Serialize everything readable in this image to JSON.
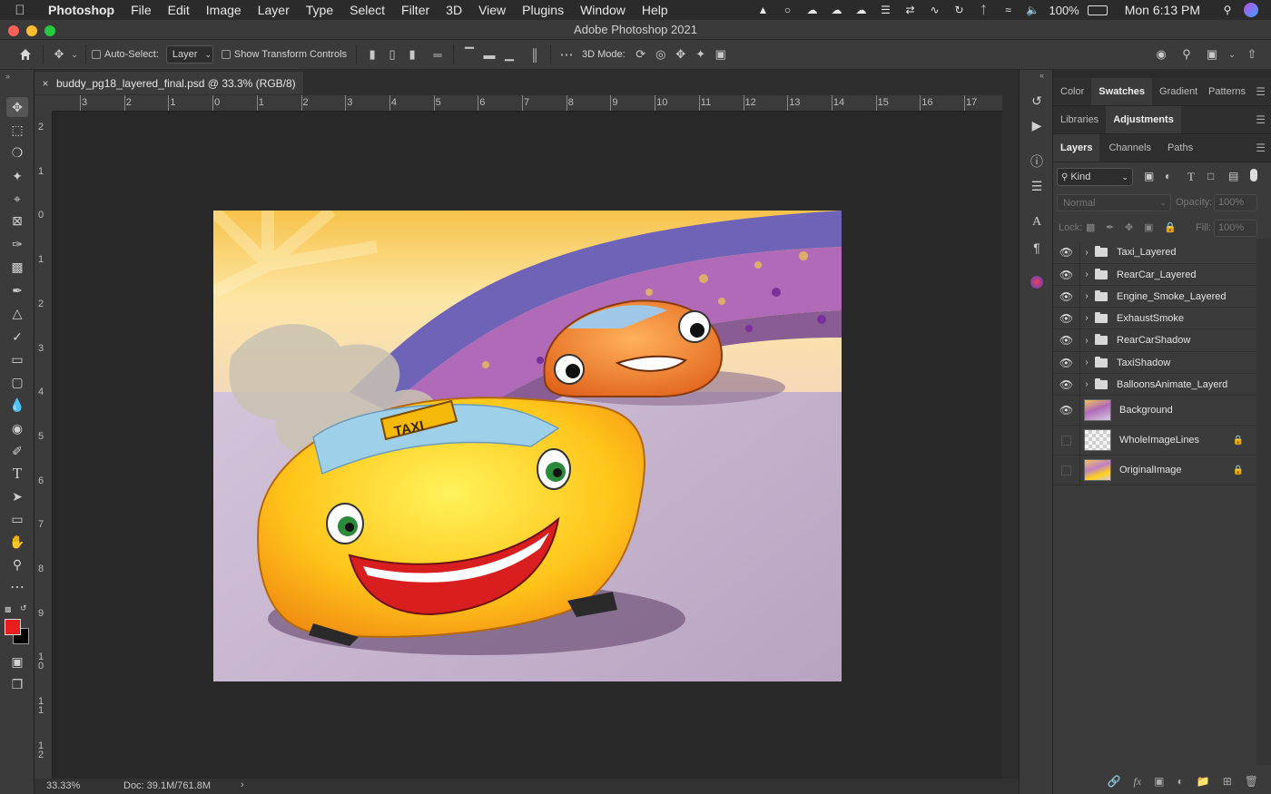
{
  "menubar": {
    "app_name": "Photoshop",
    "items": [
      "File",
      "Edit",
      "Image",
      "Layer",
      "Type",
      "Select",
      "Filter",
      "3D",
      "View",
      "Plugins",
      "Window",
      "Help"
    ],
    "battery": "100%",
    "clock": "Mon 6:13 PM"
  },
  "window": {
    "title": "Adobe Photoshop 2021"
  },
  "options": {
    "auto_select_label": "Auto-Select:",
    "auto_select_value": "Layer",
    "show_transform_label": "Show Transform Controls",
    "mode_label": "3D Mode:"
  },
  "document": {
    "tab_title": "buddy_pg18_layered_final.psd @ 33.3% (RGB/8)",
    "zoom": "33.33%",
    "doc_size": "Doc: 39.1M/761.8M"
  },
  "rulers": {
    "h": [
      "3",
      "2",
      "1",
      "0",
      "1",
      "2",
      "3",
      "4",
      "5",
      "6",
      "7",
      "8",
      "9",
      "10",
      "11",
      "12",
      "13",
      "14",
      "15",
      "16",
      "17"
    ],
    "v": [
      "2",
      "1",
      "0",
      "1",
      "2",
      "3",
      "4",
      "5",
      "6",
      "7",
      "8",
      "9",
      "10",
      "11",
      "12"
    ]
  },
  "colors": {
    "foreground": "#e81d1d",
    "background": "#000000",
    "accent": "#3b3b3b"
  },
  "panels": {
    "row1_tabs": [
      "Color",
      "Swatches",
      "Gradient",
      "Patterns"
    ],
    "row1_active": "Swatches",
    "row2_tabs": [
      "Libraries",
      "Adjustments"
    ],
    "row2_active": "Adjustments",
    "row3_tabs": [
      "Layers",
      "Channels",
      "Paths"
    ],
    "row3_active": "Layers",
    "filter_kind": "Kind",
    "blend_mode": "Normal",
    "opacity_label": "Opacity:",
    "opacity_value": "100%",
    "lock_label": "Lock:",
    "fill_label": "Fill:",
    "fill_value": "100%"
  },
  "layers": [
    {
      "name": "Taxi_Layered",
      "type": "group",
      "visible": true
    },
    {
      "name": "RearCar_Layered",
      "type": "group",
      "visible": true
    },
    {
      "name": "Engine_Smoke_Layered",
      "type": "group",
      "visible": true
    },
    {
      "name": "ExhaustSmoke",
      "type": "group",
      "visible": true
    },
    {
      "name": "RearCarShadow",
      "type": "group",
      "visible": true
    },
    {
      "name": "TaxiShadow",
      "type": "group",
      "visible": true
    },
    {
      "name": "BalloonsAnimate_Layerd",
      "type": "group",
      "visible": true
    },
    {
      "name": "Background",
      "type": "layer",
      "visible": true,
      "locked": false
    },
    {
      "name": "WholeImageLines",
      "type": "layer",
      "visible": false,
      "locked": true
    },
    {
      "name": "OriginalImage",
      "type": "layer",
      "visible": false,
      "locked": true
    }
  ],
  "artwork": {
    "taxi_sign": "TAXI"
  },
  "icons": {
    "tools": [
      "move-icon",
      "marquee-icon",
      "lasso-icon",
      "magic-wand-icon",
      "crop-icon",
      "frame-icon",
      "eyedropper-icon",
      "healing-icon",
      "brush-icon",
      "stamp-icon",
      "history-brush-icon",
      "eraser-icon",
      "gradient-icon",
      "blur-icon",
      "dodge-icon",
      "pen-icon",
      "type-icon",
      "path-select-icon",
      "rectangle-icon",
      "hand-icon",
      "zoom-icon",
      "more-tools-icon"
    ]
  }
}
